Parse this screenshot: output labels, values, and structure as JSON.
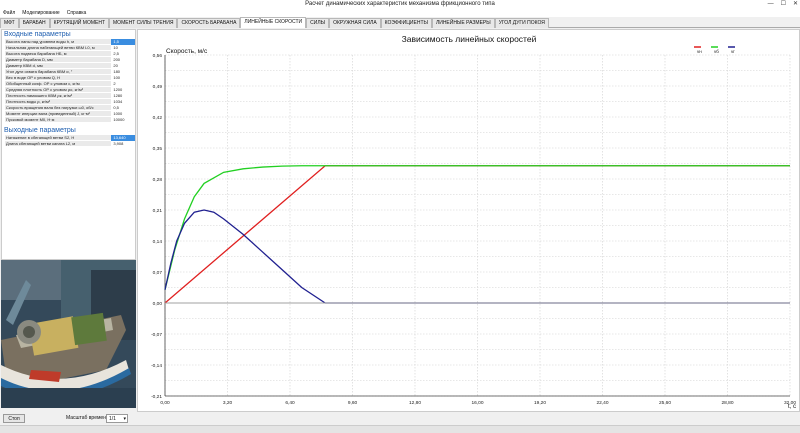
{
  "window": {
    "title": "Расчет динамических характеристик механизма фрикционного типа",
    "minimize": "—",
    "maximize": "☐",
    "close": "✕"
  },
  "menu": [
    "Файл",
    "Моделирование",
    "Справка"
  ],
  "tabs": [
    "МФТ",
    "БАРАБАН",
    "КРУТЯЩИЙ МОМЕНТ",
    "МОМЕНТ СИЛЫ ТРЕНИЯ",
    "СКОРОСТЬ БАРАБАНА",
    "ЛИНЕЙНЫЕ СКОРОСТИ",
    "СИЛЫ",
    "ОКРУЖНАЯ СИЛА",
    "КОЭФФИЦИЕНТЫ",
    "ЛИНЕЙНЫЕ РАЗМЕРЫ",
    "УГОЛ ДУГИ ПОКОЯ"
  ],
  "active_tab": "ЛИНЕЙНЫЕ СКОРОСТИ",
  "input_section": {
    "title": "Входные параметры",
    "params": [
      {
        "label": "Высота лапы над уровнем воды h, м",
        "value": "1,5"
      },
      {
        "label": "Начальная длина набегающей ветви КВМ L0, м",
        "value": "10"
      },
      {
        "label": "Высота подвеса барабана НБ, м",
        "value": "2,5"
      },
      {
        "label": "Диаметр барабана D, мм",
        "value": "200"
      },
      {
        "label": "Диаметр КВМ d, мм",
        "value": "20"
      },
      {
        "label": "Угол дуги охвата барабана КВМ α, °",
        "value": "180"
      },
      {
        "label": "Вес в воде ОР с уловом Q, Н",
        "value": "100"
      },
      {
        "label": "Обобщенный коэф. ОР с уловом c, кг/м",
        "value": "2"
      },
      {
        "label": "Средняя плотность ОР с уловом ρо, кг/м³",
        "value": "1200"
      },
      {
        "label": "Плотность намокшего КВМ ρк, кг/м³",
        "value": "1280"
      },
      {
        "label": "Плотность воды ρ, кг/м³",
        "value": "1034"
      },
      {
        "label": "Скорость вращения вала без нагрузки ω0, об/с",
        "value": "0,5"
      },
      {
        "label": "Момент инерции вала (приведенный) J, кг·м²",
        "value": "1000"
      },
      {
        "label": "Пусковой момент М0, Н·м",
        "value": "10000"
      }
    ]
  },
  "output_section": {
    "title": "Выходные параметры",
    "params": [
      {
        "label": "Натяжение в сбегающей ветви S2, Н",
        "value": "13,640"
      },
      {
        "label": "Длина сбегающей ветви каната L2, м",
        "value": "3,908"
      }
    ]
  },
  "bottom": {
    "stop_label": "Стоп",
    "scale_label": "Масштаб времени",
    "scale_value": "1/1"
  },
  "chart_data": {
    "type": "line",
    "title": "Зависимость линейных скоростей",
    "ylabel": "Скорость, м/с",
    "xlabel": "t, с",
    "xlim": [
      0,
      32
    ],
    "ylim": [
      -0.21,
      0.56
    ],
    "xticks": [
      "0,00",
      "3,20",
      "6,40",
      "9,60",
      "12,80",
      "16,00",
      "19,20",
      "22,40",
      "25,60",
      "28,80",
      "32,00"
    ],
    "yticks": [
      "-0,21",
      "-0,18",
      "-0,14",
      "-0,11",
      "-0,07",
      "-0,04",
      "0,00",
      "0,04",
      "0,07",
      "0,11",
      "0,14",
      "0,18",
      "0,21",
      "0,25",
      "0,28",
      "0,32",
      "0,35",
      "0,39",
      "0,42",
      "0,46",
      "0,49",
      "0,53",
      "0,56"
    ],
    "grid": true,
    "legend_position": "top-right",
    "series": [
      {
        "name": "vн",
        "color": "#e02020",
        "x": [
          0,
          8.2,
          32
        ],
        "y": [
          0,
          0.31,
          0.31
        ]
      },
      {
        "name": "vб",
        "color": "#22d022",
        "x": [
          0,
          0.5,
          1,
          1.5,
          2,
          3,
          4,
          5,
          6,
          7,
          8,
          10,
          32
        ],
        "y": [
          0.03,
          0.12,
          0.19,
          0.24,
          0.27,
          0.295,
          0.303,
          0.307,
          0.309,
          0.31,
          0.31,
          0.31,
          0.31
        ]
      },
      {
        "name": "vг",
        "color": "#202090",
        "x": [
          0,
          0.3,
          0.6,
          1,
          1.5,
          2,
          2.5,
          3,
          4,
          5,
          6,
          7,
          8.2,
          32
        ],
        "y": [
          0.03,
          0.09,
          0.14,
          0.18,
          0.205,
          0.21,
          0.205,
          0.19,
          0.155,
          0.115,
          0.075,
          0.035,
          0,
          0
        ]
      },
      {
        "name": "zero",
        "color": "#a0a0a0",
        "x": [
          0,
          32
        ],
        "y": [
          0,
          0
        ]
      }
    ]
  }
}
